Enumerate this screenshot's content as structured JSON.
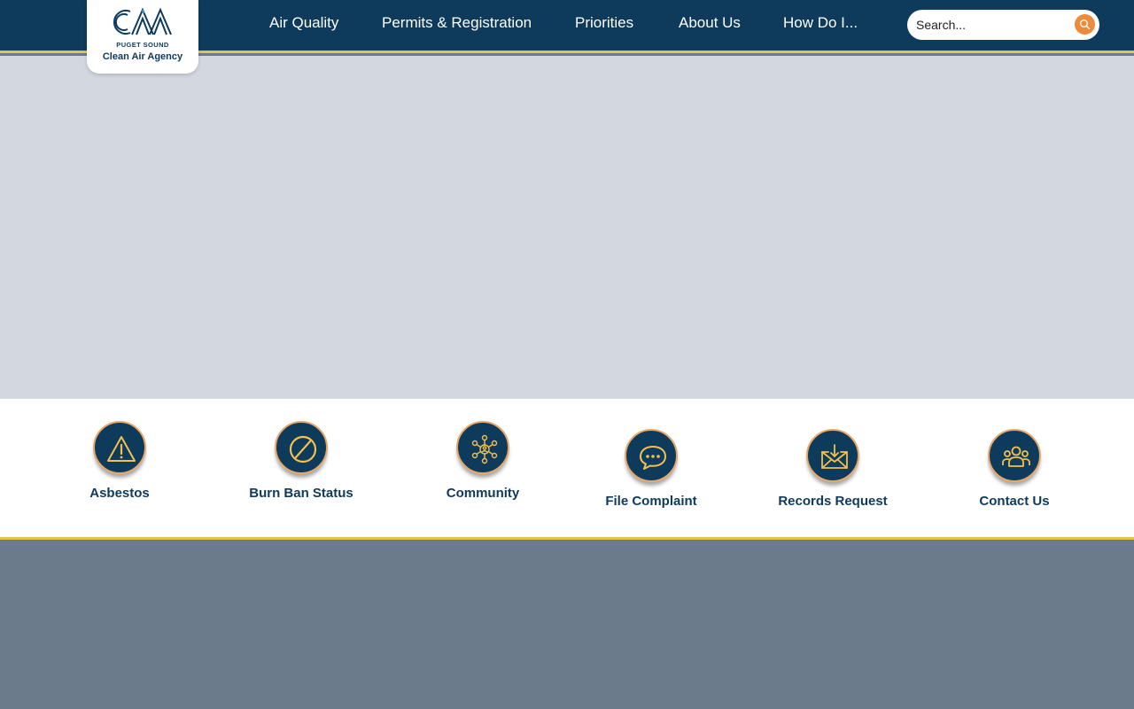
{
  "logo": {
    "line1": "PUGET SOUND",
    "line2": "Clean Air Agency"
  },
  "nav": [
    {
      "label": "Air Quality"
    },
    {
      "label": "Permits & Registration"
    },
    {
      "label": "Priorities"
    },
    {
      "label": "About Us"
    },
    {
      "label": "How Do I..."
    }
  ],
  "search": {
    "placeholder": "Search...",
    "value": ""
  },
  "quick_links": [
    {
      "label": "Asbestos",
      "icon": "warning-icon"
    },
    {
      "label": "Burn Ban Status",
      "icon": "prohibited-icon"
    },
    {
      "label": "Community",
      "icon": "network-icon"
    },
    {
      "label": "File Complaint",
      "icon": "chat-bubble-icon"
    },
    {
      "label": "Records Request",
      "icon": "mail-inbox-icon"
    },
    {
      "label": "Contact Us",
      "icon": "people-icon"
    }
  ],
  "colors": {
    "header_bg": "#0e3a5c",
    "accent_gold": "#e8c04a",
    "icon_gold": "#f2c14e",
    "search_orange": "#ef8a3c",
    "hero_bg": "#d3d7df",
    "footer_bg": "#6b7b8c"
  }
}
